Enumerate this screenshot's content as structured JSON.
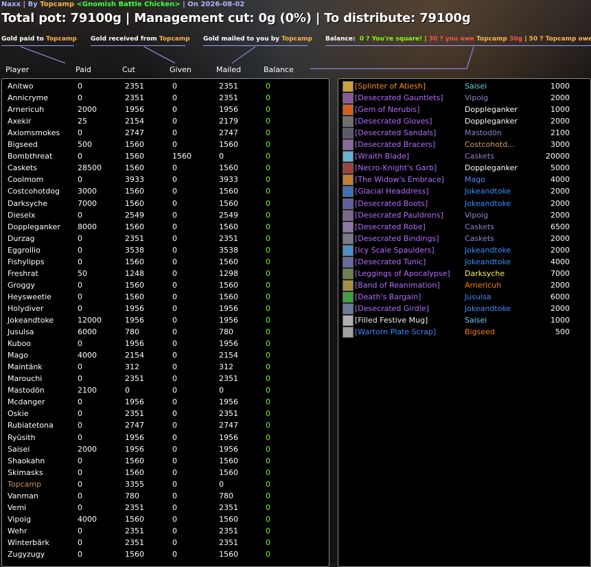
{
  "header": {
    "raid": "Naxx",
    "by": "By",
    "author": "Topcamp",
    "guild": "<Gnomish Battle Chicken>",
    "on": "On 2026-08-02",
    "title": "Total pot: 79100g | Management cut: 0g (0%) | To distribute: 79100g"
  },
  "legend": {
    "paid_prefix": "Gold paid to ",
    "received_prefix": "Gold received from ",
    "mailed_prefix": "Gold mailed to you by ",
    "name": "Topcamp",
    "balance_label": "Balance:",
    "square": "0 ? You're square!",
    "owe1": "30 ? you owe ",
    "owe1_amount": "30g",
    "owe2": "50 ? Topcamp owe"
  },
  "columns": [
    "Player",
    "Paid",
    "Cut",
    "Given",
    "Mailed",
    "Balance"
  ],
  "players": [
    {
      "name": "Anitwo",
      "paid": "0",
      "cut": "2351",
      "given": "0",
      "mailed": "2351",
      "balance": "0"
    },
    {
      "name": "Annicryme",
      "paid": "0",
      "cut": "2351",
      "given": "0",
      "mailed": "2351",
      "balance": "0"
    },
    {
      "name": "Arnericuh",
      "paid": "2000",
      "cut": "1956",
      "given": "0",
      "mailed": "1956",
      "balance": "0"
    },
    {
      "name": "Axekir",
      "paid": "25",
      "cut": "2154",
      "given": "0",
      "mailed": "2179",
      "balance": "0"
    },
    {
      "name": "Axiomsmokes",
      "paid": "0",
      "cut": "2747",
      "given": "0",
      "mailed": "2747",
      "balance": "0"
    },
    {
      "name": "Bigseed",
      "paid": "500",
      "cut": "1560",
      "given": "0",
      "mailed": "1560",
      "balance": "0"
    },
    {
      "name": "Bombthreat",
      "paid": "0",
      "cut": "1560",
      "given": "1560",
      "mailed": "0",
      "balance": "0"
    },
    {
      "name": "Caskets",
      "paid": "28500",
      "cut": "1560",
      "given": "0",
      "mailed": "1560",
      "balance": "0"
    },
    {
      "name": "Coolmom",
      "paid": "0",
      "cut": "3933",
      "given": "0",
      "mailed": "3933",
      "balance": "0"
    },
    {
      "name": "Costcohotdog",
      "paid": "3000",
      "cut": "1560",
      "given": "0",
      "mailed": "1560",
      "balance": "0"
    },
    {
      "name": "Darksyche",
      "paid": "7000",
      "cut": "1560",
      "given": "0",
      "mailed": "1560",
      "balance": "0"
    },
    {
      "name": "Dieselx",
      "paid": "0",
      "cut": "2549",
      "given": "0",
      "mailed": "2549",
      "balance": "0"
    },
    {
      "name": "Doppleganker",
      "paid": "8000",
      "cut": "1560",
      "given": "0",
      "mailed": "1560",
      "balance": "0"
    },
    {
      "name": "Durzag",
      "paid": "0",
      "cut": "2351",
      "given": "0",
      "mailed": "2351",
      "balance": "0"
    },
    {
      "name": "Eggrollio",
      "paid": "0",
      "cut": "3538",
      "given": "0",
      "mailed": "3538",
      "balance": "0"
    },
    {
      "name": "Fishylipps",
      "paid": "0",
      "cut": "1560",
      "given": "0",
      "mailed": "1560",
      "balance": "0"
    },
    {
      "name": "Freshrat",
      "paid": "50",
      "cut": "1248",
      "given": "0",
      "mailed": "1298",
      "balance": "0"
    },
    {
      "name": "Groggy",
      "paid": "0",
      "cut": "1560",
      "given": "0",
      "mailed": "1560",
      "balance": "0"
    },
    {
      "name": "Heysweetie",
      "paid": "0",
      "cut": "1560",
      "given": "0",
      "mailed": "1560",
      "balance": "0"
    },
    {
      "name": "Holydiver",
      "paid": "0",
      "cut": "1956",
      "given": "0",
      "mailed": "1956",
      "balance": "0"
    },
    {
      "name": "Jokeandtoke",
      "paid": "12000",
      "cut": "1956",
      "given": "0",
      "mailed": "1956",
      "balance": "0"
    },
    {
      "name": "Jusulsa",
      "paid": "6000",
      "cut": "780",
      "given": "0",
      "mailed": "780",
      "balance": "0"
    },
    {
      "name": "Kuboo",
      "paid": "0",
      "cut": "1956",
      "given": "0",
      "mailed": "1956",
      "balance": "0"
    },
    {
      "name": "Mago",
      "paid": "4000",
      "cut": "2154",
      "given": "0",
      "mailed": "2154",
      "balance": "0"
    },
    {
      "name": "Maintänk",
      "paid": "0",
      "cut": "312",
      "given": "0",
      "mailed": "312",
      "balance": "0"
    },
    {
      "name": "Marouchi",
      "paid": "0",
      "cut": "2351",
      "given": "0",
      "mailed": "2351",
      "balance": "0"
    },
    {
      "name": "Mastodön",
      "paid": "2100",
      "cut": "0",
      "given": "0",
      "mailed": "0",
      "balance": "0"
    },
    {
      "name": "Mcdanger",
      "paid": "0",
      "cut": "1956",
      "given": "0",
      "mailed": "1956",
      "balance": "0"
    },
    {
      "name": "Oskie",
      "paid": "0",
      "cut": "2351",
      "given": "0",
      "mailed": "2351",
      "balance": "0"
    },
    {
      "name": "Rubiatetona",
      "paid": "0",
      "cut": "2747",
      "given": "0",
      "mailed": "2747",
      "balance": "0"
    },
    {
      "name": "Ryüsith",
      "paid": "0",
      "cut": "1956",
      "given": "0",
      "mailed": "1956",
      "balance": "0"
    },
    {
      "name": "Saisei",
      "paid": "2000",
      "cut": "1956",
      "given": "0",
      "mailed": "1956",
      "balance": "0"
    },
    {
      "name": "Shaokahn",
      "paid": "0",
      "cut": "1560",
      "given": "0",
      "mailed": "1560",
      "balance": "0"
    },
    {
      "name": "Skimasks",
      "paid": "0",
      "cut": "1560",
      "given": "0",
      "mailed": "1560",
      "balance": "0"
    },
    {
      "name": "Topcamp",
      "paid": "0",
      "cut": "3355",
      "given": "0",
      "mailed": "0",
      "balance": "0",
      "highlight": true
    },
    {
      "name": "Vanman",
      "paid": "0",
      "cut": "780",
      "given": "0",
      "mailed": "780",
      "balance": "0"
    },
    {
      "name": "Vemi",
      "paid": "0",
      "cut": "2351",
      "given": "0",
      "mailed": "2351",
      "balance": "0"
    },
    {
      "name": "Vipoig",
      "paid": "4000",
      "cut": "1560",
      "given": "0",
      "mailed": "1560",
      "balance": "0"
    },
    {
      "name": "Wehr",
      "paid": "0",
      "cut": "2351",
      "given": "0",
      "mailed": "2351",
      "balance": "0"
    },
    {
      "name": "Winterbärk",
      "paid": "0",
      "cut": "2351",
      "given": "0",
      "mailed": "2351",
      "balance": "0"
    },
    {
      "name": "Zugyzugy",
      "paid": "0",
      "cut": "1560",
      "given": "0",
      "mailed": "1560",
      "balance": "0"
    }
  ],
  "items": [
    {
      "item": "[Splinter of Atiesh]",
      "quality": "leg",
      "winner": "Saisei",
      "cls": "p-mage",
      "price": "1000",
      "icon": "#c8a040"
    },
    {
      "item": "[Desecrated Gauntlets]",
      "quality": "epic",
      "winner": "Vipoig",
      "cls": "p-warlock",
      "price": "2000",
      "icon": "#8a5a9a"
    },
    {
      "item": "[Gem of Nerubis]",
      "quality": "epic",
      "winner": "Doppleganker",
      "cls": "p-priest",
      "price": "1000",
      "icon": "#d06020"
    },
    {
      "item": "[Desecrated Gloves]",
      "quality": "epic",
      "winner": "Doppleganker",
      "cls": "p-priest",
      "price": "2000",
      "icon": "#707070"
    },
    {
      "item": "[Desecrated Sandals]",
      "quality": "epic",
      "winner": "Mastodön",
      "cls": "p-warlock",
      "price": "2100",
      "icon": "#5a5a6a"
    },
    {
      "item": "[Desecrated Bracers]",
      "quality": "epic",
      "winner": "Costcohotd...",
      "cls": "p-druid-alt",
      "price": "3000",
      "icon": "#8a6a9a"
    },
    {
      "item": "[Wraith Blade]",
      "quality": "epic",
      "winner": "Caskets",
      "cls": "p-warlock",
      "price": "20000",
      "icon": "#6ab0d0"
    },
    {
      "item": "[Necro-Knight's Garb]",
      "quality": "epic",
      "winner": "Doppleganker",
      "cls": "p-priest",
      "price": "5000",
      "icon": "#a04040"
    },
    {
      "item": "[The Widow's Embrace]",
      "quality": "epic",
      "winner": "Mago",
      "cls": "p-mage-blue",
      "price": "4000",
      "icon": "#c08030"
    },
    {
      "item": "[Glacial Headdress]",
      "quality": "epic",
      "winner": "Jokeandtoke",
      "cls": "p-shaman",
      "price": "2000",
      "icon": "#4070b0"
    },
    {
      "item": "[Desecrated Boots]",
      "quality": "epic",
      "winner": "Jokeandtoke",
      "cls": "p-shaman",
      "price": "2000",
      "icon": "#6060a0"
    },
    {
      "item": "[Desecrated Pauldrons]",
      "quality": "epic",
      "winner": "Vipoig",
      "cls": "p-warlock",
      "price": "2000",
      "icon": "#7a6a8a"
    },
    {
      "item": "[Desecrated Robe]",
      "quality": "epic",
      "winner": "Caskets",
      "cls": "p-warlock",
      "price": "6500",
      "icon": "#8a7aa0"
    },
    {
      "item": "[Desecrated Bindings]",
      "quality": "epic",
      "winner": "Caskets",
      "cls": "p-warlock",
      "price": "2000",
      "icon": "#7a7a8a"
    },
    {
      "item": "[Icy Scale Spaulders]",
      "quality": "epic",
      "winner": "Jokeandtoke",
      "cls": "p-shaman",
      "price": "2000",
      "icon": "#5090c0"
    },
    {
      "item": "[Desecrated Tunic]",
      "quality": "epic",
      "winner": "Jokeandtoke",
      "cls": "p-shaman",
      "price": "4000",
      "icon": "#6a6aa0"
    },
    {
      "item": "[Leggings of Apocalypse]",
      "quality": "epic",
      "winner": "Darksyche",
      "cls": "p-rogue",
      "price": "7000",
      "icon": "#708050"
    },
    {
      "item": "[Band of Reanimation]",
      "quality": "epic",
      "winner": "Arnericuh",
      "cls": "p-druid",
      "price": "2000",
      "icon": "#a09040"
    },
    {
      "item": "[Death's Bargain]",
      "quality": "epic",
      "winner": "Jusulsa",
      "cls": "p-shaman",
      "price": "6000",
      "icon": "#40a040"
    },
    {
      "item": "[Desecrated Girdle]",
      "quality": "epic",
      "winner": "Jokeandtoke",
      "cls": "p-shaman",
      "price": "2000",
      "icon": "#6a7a9a"
    },
    {
      "item": "[Filled Festive Mug]",
      "quality": "common",
      "winner": "Saisei",
      "cls": "p-mage",
      "price": "1000",
      "icon": "#b0b0b0"
    },
    {
      "item": "[Wartorn Plate Scrap]",
      "quality": "rare",
      "winner": "Bigseed",
      "cls": "p-druid",
      "price": "500",
      "icon": "#a0a0a0"
    }
  ],
  "colors": {
    "balance_zero": "#7fff00",
    "highlight_player": "#c8964a"
  }
}
